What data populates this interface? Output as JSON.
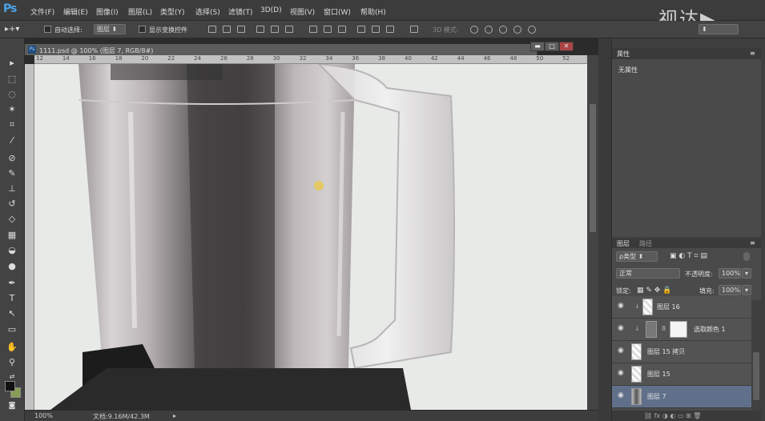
{
  "app": {
    "logo": "Ps",
    "watermark": "视达▶"
  },
  "menu": [
    "文件(F)",
    "编辑(E)",
    "图像(I)",
    "图层(L)",
    "类型(Y)",
    "选择(S)",
    "滤镜(T)",
    "3D(D)",
    "视图(V)",
    "窗口(W)",
    "帮助(H)"
  ],
  "options": {
    "auto_select": "自动选择:",
    "auto_select_target": "图层",
    "show_transform": "显示变换控件",
    "mode_3d": "3D 模式:"
  },
  "document": {
    "tab_title": "1111.psd @ 100% (图层 7, RGB/8#)",
    "ruler_marks": [
      "12",
      "14",
      "16",
      "18",
      "20",
      "22",
      "24",
      "26",
      "28",
      "30",
      "32",
      "34",
      "36",
      "38",
      "40",
      "42",
      "44",
      "46",
      "48",
      "50",
      "52"
    ]
  },
  "status": {
    "zoom": "100%",
    "doc_size": "文档:9.16M/42.3M"
  },
  "properties": {
    "tabs": [
      "属性"
    ],
    "empty_text": "无属性"
  },
  "layers_panel": {
    "tabs": [
      "图层",
      "路径"
    ],
    "filter_kind": "ρ类型",
    "blend_mode": "正常",
    "opacity_label": "不透明度:",
    "opacity_value": "100%",
    "lock_label": "锁定:",
    "fill_label": "填充:",
    "fill_value": "100%",
    "layers": [
      {
        "name": "图层 16",
        "active": false
      },
      {
        "name": "选取颜色 1",
        "active": false
      },
      {
        "name": "图层 15 拷贝",
        "active": false
      },
      {
        "name": "图层 15",
        "active": false
      },
      {
        "name": "图层 7",
        "active": true
      }
    ]
  },
  "colors": {
    "foreground": "#111111",
    "background": "#8a9d55",
    "accent": "#4aa3e8"
  }
}
